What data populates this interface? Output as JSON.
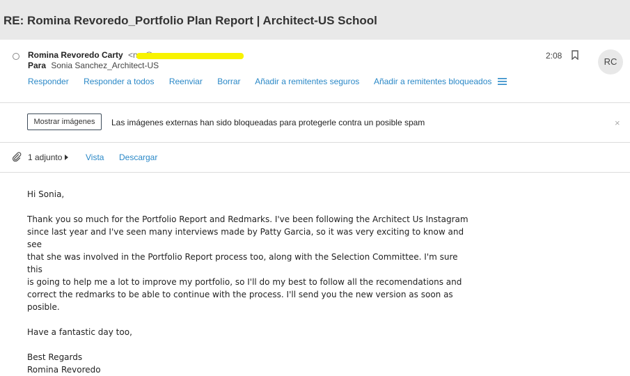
{
  "subject": "RE: Romina Revoredo_Portfolio Plan Report | Architect-US School",
  "sender": {
    "name": "Romina Revoredo Carty",
    "email_visible": "<n...@...m>",
    "to_label": "Para",
    "to_value": "Sonia Sanchez_Architect-US",
    "time": "2:08",
    "avatar_initials": "RC",
    "redaction_color": "#f8f300"
  },
  "actions": [
    "Responder",
    "Responder a todos",
    "Reenviar",
    "Borrar",
    "Añadir a remitentes seguros",
    "Añadir a remitentes bloqueados"
  ],
  "notice": {
    "button_label": "Mostrar imágenes",
    "message": "Las imágenes externas han sido bloqueadas para protegerle contra un posible spam",
    "close_symbol": "×"
  },
  "attachments": {
    "count_label": "1 adjunto",
    "view_label": "Vista",
    "download_label": "Descargar"
  },
  "body": {
    "greeting": "Hi Sonia,",
    "paragraph_lines": [
      "Thank you so much for the Portfolio Report and Redmarks. I've been following the Architect Us Instagram",
      "since last year and I've seen many interviews made by Patty Garcia, so it was very exciting to know and see",
      "that she was involved in the Portfolio Report process too, along with the Selection Committee. I'm sure this",
      "is going to help me a lot to improve my portfolio, so I'll do my best to follow all the recomendations and",
      "correct the redmarks to be able to continue with the process. I'll send you the new version as soon as",
      "posible."
    ],
    "closing_wish": "Have a fantastic day too,",
    "signoff": "Best Regards",
    "signature": "Romina Revoredo"
  },
  "colors": {
    "link": "#2a88c7",
    "header_bg": "#e9e9e9"
  }
}
